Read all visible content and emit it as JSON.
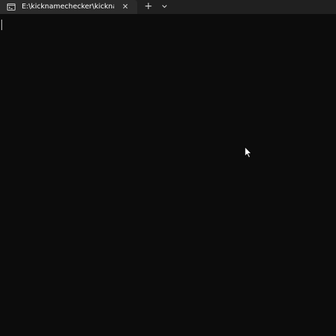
{
  "tab": {
    "title": "E:\\kicknamechecker\\kicknamechecker",
    "icon": "terminal-icon",
    "close_icon": "close-icon",
    "close_glyph": "✕"
  },
  "toolbar": {
    "new_tab_icon": "plus-icon",
    "new_tab_glyph": "+",
    "dropdown_icon": "chevron-down-icon"
  },
  "terminal": {
    "content": ""
  },
  "colors": {
    "tabbar_bg": "#202020",
    "active_tab_bg": "#2b2b2b",
    "terminal_bg": "#0c0c0c",
    "text": "#ffffff"
  }
}
